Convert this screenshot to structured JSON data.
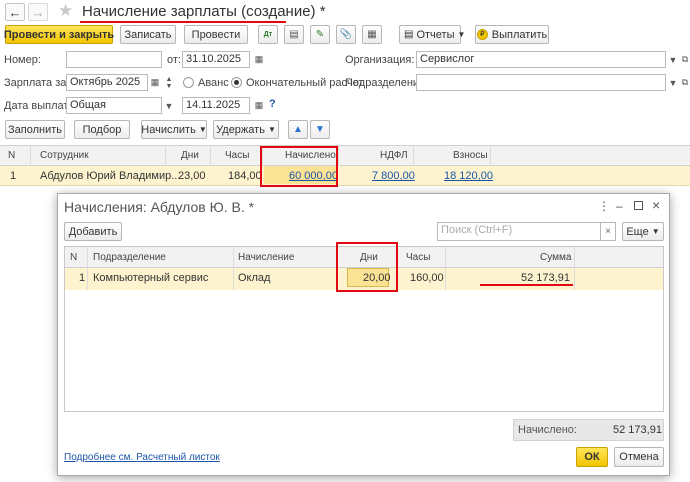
{
  "window": {
    "title": "Начисление зарплаты (создание)",
    "modified_mark": "*"
  },
  "toolbar": {
    "post_close": "Провести и закрыть",
    "save": "Записать",
    "post": "Провести",
    "reports": "Отчеты",
    "pay": "Выплатить"
  },
  "form": {
    "number_label": "Номер:",
    "number_value": "",
    "from_label": "от:",
    "date_value": "31.10.2025",
    "org_label": "Организация:",
    "org_value": "Сервислог",
    "period_label": "Зарплата за:",
    "period_value": "Октябрь 2025",
    "advance_label": "Аванс",
    "final_label": "Окончательный расчет",
    "dept_label": "Подразделение:",
    "dept_value": "",
    "paydate_label": "Дата выплаты:",
    "paydate_type": "Общая",
    "paydate_value": "14.11.2025",
    "help": "?"
  },
  "actions": {
    "fill": "Заполнить",
    "select": "Подбор",
    "accrue": "Начислить",
    "withhold": "Удержать"
  },
  "main_table": {
    "headers": [
      "N",
      "Сотрудник",
      "Дни",
      "Часы",
      "Начислено",
      "НДФЛ",
      "Взносы"
    ],
    "rows": [
      {
        "n": "1",
        "employee": "Абдулов Юрий Владимир...",
        "days": "23,00",
        "hours": "184,00",
        "accrued": "60 000,00",
        "ndfl": "7 800,00",
        "contrib": "18 120,00"
      }
    ]
  },
  "dialog": {
    "title": "Начисления: Абдулов Ю. В. *",
    "add": "Добавить",
    "search_placeholder": "Поиск (Ctrl+F)",
    "more": "Еще",
    "headers": [
      "N",
      "Подразделение",
      "Начисление",
      "Дни",
      "Часы",
      "Сумма"
    ],
    "rows": [
      {
        "n": "1",
        "dept": "Компьютерный сервис",
        "accrual": "Оклад",
        "days": "20,00",
        "hours": "160,00",
        "sum": "52 173,91"
      }
    ],
    "total_label": "Начислено:",
    "total_value": "52 173,91",
    "details_link": "Подробнее см. Расчетный листок",
    "ok": "ОК",
    "cancel": "Отмена"
  },
  "colors": {
    "highlight": "#e30613",
    "accent": "#f2c500",
    "selected_row": "#fdf3cf"
  }
}
